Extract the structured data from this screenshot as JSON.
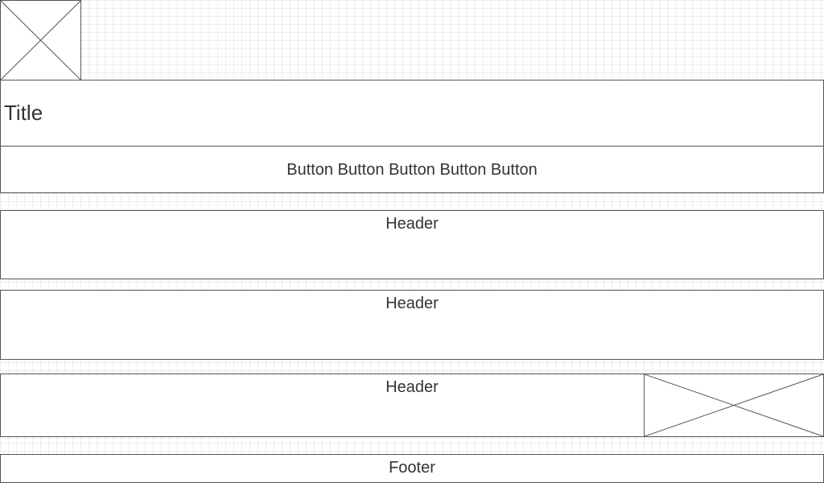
{
  "title": "Title",
  "nav": {
    "buttons": [
      "Button",
      "Button",
      "Button",
      "Button",
      "Button"
    ]
  },
  "sections": [
    {
      "header": "Header"
    },
    {
      "header": "Header"
    },
    {
      "header": "Header"
    }
  ],
  "footer": "Footer",
  "colors": {
    "border": "#555555",
    "text": "#333333",
    "grid": "#ececec",
    "background": "#ffffff"
  },
  "icons": {
    "image_placeholder": "image-placeholder-icon"
  }
}
